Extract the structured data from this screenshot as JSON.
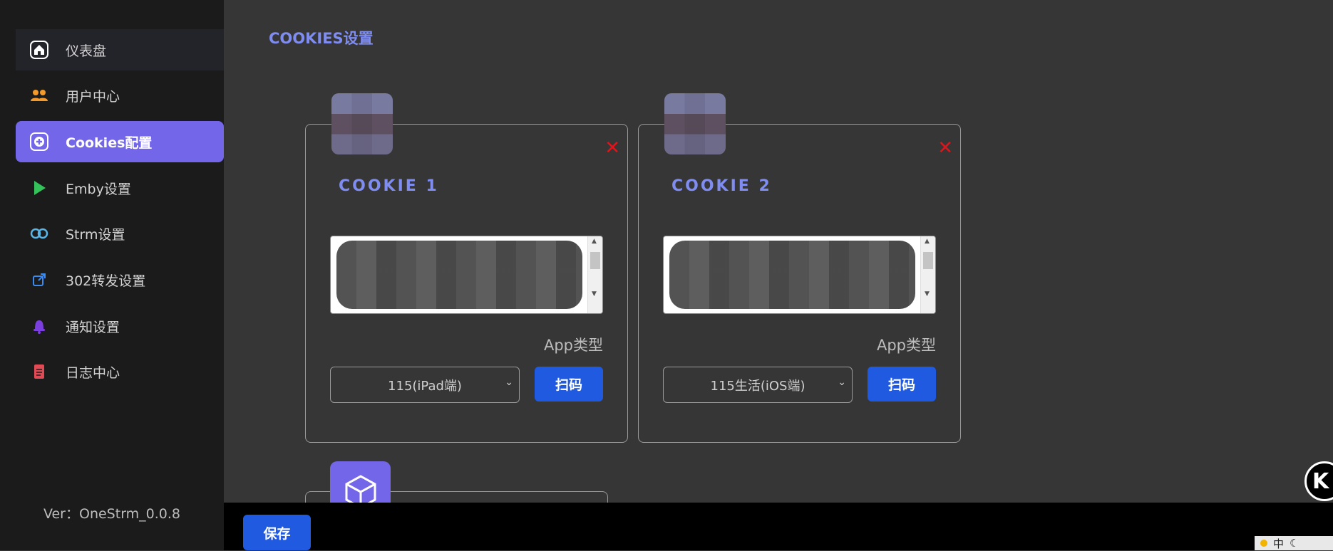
{
  "sidebar": {
    "items": [
      {
        "label": "仪表盘",
        "icon": "home-icon",
        "color": "#ffffff"
      },
      {
        "label": "用户中心",
        "icon": "users-icon",
        "color": "#f39a2b"
      },
      {
        "label": "Cookies配置",
        "icon": "plus-circle-icon",
        "color": "#ffffff"
      },
      {
        "label": "Emby设置",
        "icon": "play-icon",
        "color": "#33c35a"
      },
      {
        "label": "Strm设置",
        "icon": "link-icon",
        "color": "#5ab6e6"
      },
      {
        "label": "302转发设置",
        "icon": "external-link-icon",
        "color": "#3b8cf0"
      },
      {
        "label": "通知设置",
        "icon": "bell-icon",
        "color": "#7b3fe0"
      },
      {
        "label": "日志中心",
        "icon": "document-icon",
        "color": "#e04a55"
      }
    ],
    "version": "Ver：OneStrm_0.0.8"
  },
  "main": {
    "title": "COOKIES设置",
    "cards": [
      {
        "title": "COOKIE 1",
        "app_type_label": "App类型",
        "selected_app": "115(iPad端)",
        "scan_label": "扫码"
      },
      {
        "title": "COOKIE 2",
        "app_type_label": "App类型",
        "selected_app": "115生活(iOS端)",
        "scan_label": "扫码"
      }
    ]
  },
  "bottom_bar": {
    "save_label": "保存"
  },
  "floating": {
    "k_label": "K"
  },
  "ime": {
    "lang": "中"
  },
  "colors": {
    "accent": "#7366e8",
    "title": "#7f8cf0",
    "primary_button": "#1f5ae0",
    "close": "#e0141b"
  }
}
